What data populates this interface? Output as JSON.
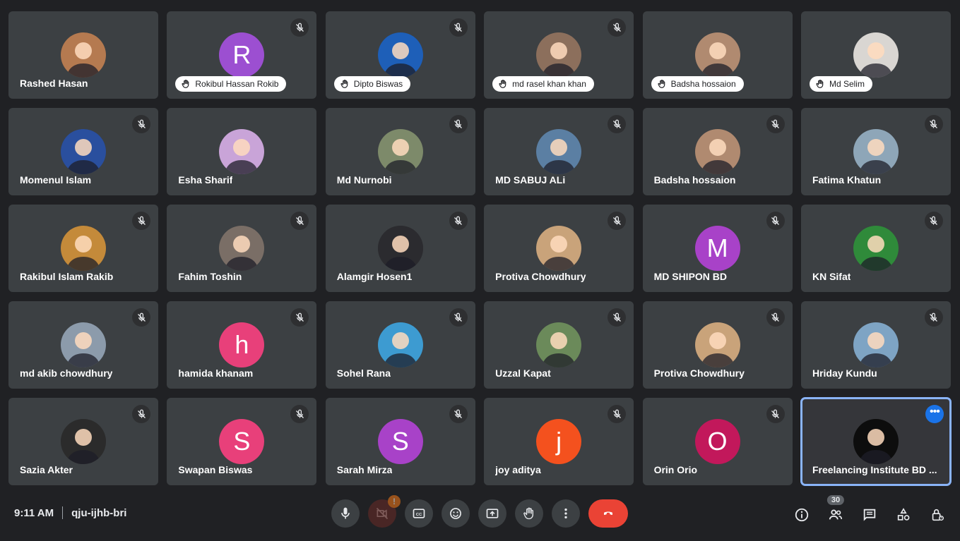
{
  "participants": [
    {
      "name": "Rashed Hasan",
      "avatar": "photo",
      "avatar_color": "#b57a50",
      "muted": false,
      "hand_raised": false
    },
    {
      "name": "Rokibul Hassan Rokib",
      "avatar": "R",
      "avatar_color": "#9c4fd1",
      "muted": true,
      "hand_raised": true
    },
    {
      "name": "Dipto Biswas",
      "avatar": "photo",
      "avatar_color": "#1e5fb8",
      "muted": true,
      "hand_raised": true
    },
    {
      "name": "md rasel khan khan",
      "avatar": "photo",
      "avatar_color": "#8c6f5c",
      "muted": true,
      "hand_raised": true
    },
    {
      "name": "Badsha hossaion",
      "avatar": "photo",
      "avatar_color": "#b08a70",
      "muted": false,
      "hand_raised": true
    },
    {
      "name": "Md Selim",
      "avatar": "photo",
      "avatar_color": "#d9d6d2",
      "muted": false,
      "hand_raised": true
    },
    {
      "name": "Momenul Islam",
      "avatar": "photo",
      "avatar_color": "#2a4f9e",
      "muted": true,
      "hand_raised": false
    },
    {
      "name": "Esha Sharif",
      "avatar": "photo",
      "avatar_color": "#c9a4d8",
      "muted": false,
      "hand_raised": false
    },
    {
      "name": "Md Nurnobi",
      "avatar": "photo",
      "avatar_color": "#7d8a6a",
      "muted": true,
      "hand_raised": false
    },
    {
      "name": "MD SABUJ ALi",
      "avatar": "photo",
      "avatar_color": "#5b7fa3",
      "muted": true,
      "hand_raised": false
    },
    {
      "name": "Badsha hossaion",
      "avatar": "photo",
      "avatar_color": "#b08a70",
      "muted": true,
      "hand_raised": false
    },
    {
      "name": "Fatima Khatun",
      "avatar": "photo",
      "avatar_color": "#8ea6b8",
      "muted": true,
      "hand_raised": false
    },
    {
      "name": "Rakibul Islam Rakib",
      "avatar": "photo",
      "avatar_color": "#c48a3a",
      "muted": true,
      "hand_raised": false
    },
    {
      "name": "Fahim Toshin",
      "avatar": "photo",
      "avatar_color": "#7a6e66",
      "muted": true,
      "hand_raised": false
    },
    {
      "name": "Alamgir Hosen1",
      "avatar": "photo",
      "avatar_color": "#2b2b2f",
      "muted": true,
      "hand_raised": false
    },
    {
      "name": "Protiva Chowdhury",
      "avatar": "photo",
      "avatar_color": "#c9a37a",
      "muted": true,
      "hand_raised": false
    },
    {
      "name": "MD SHIPON BD",
      "avatar": "M",
      "avatar_color": "#a842c8",
      "muted": true,
      "hand_raised": false
    },
    {
      "name": "KN Sifat",
      "avatar": "photo",
      "avatar_color": "#2f8a3a",
      "muted": true,
      "hand_raised": false
    },
    {
      "name": "md akib chowdhury",
      "avatar": "photo",
      "avatar_color": "#8c9bab",
      "muted": true,
      "hand_raised": false
    },
    {
      "name": "hamida khanam",
      "avatar": "h",
      "avatar_color": "#e8407a",
      "muted": true,
      "hand_raised": false
    },
    {
      "name": "Sohel Rana",
      "avatar": "photo",
      "avatar_color": "#3d9bd1",
      "muted": true,
      "hand_raised": false
    },
    {
      "name": "Uzzal Kapat",
      "avatar": "photo",
      "avatar_color": "#6b8a5a",
      "muted": true,
      "hand_raised": false
    },
    {
      "name": "Protiva Chowdhury",
      "avatar": "photo",
      "avatar_color": "#c9a37a",
      "muted": true,
      "hand_raised": false
    },
    {
      "name": "Hriday Kundu",
      "avatar": "photo",
      "avatar_color": "#7ea4c4",
      "muted": true,
      "hand_raised": false
    },
    {
      "name": "Sazia Akter",
      "avatar": "photo",
      "avatar_color": "#2b2b2b",
      "muted": true,
      "hand_raised": false
    },
    {
      "name": "Swapan Biswas",
      "avatar": "S",
      "avatar_color": "#e8407a",
      "muted": true,
      "hand_raised": false
    },
    {
      "name": "Sarah Mirza",
      "avatar": "S",
      "avatar_color": "#a842c8",
      "muted": true,
      "hand_raised": false
    },
    {
      "name": "joy aditya",
      "avatar": "j",
      "avatar_color": "#f4511e",
      "muted": true,
      "hand_raised": false
    },
    {
      "name": "Orin Orio",
      "avatar": "O",
      "avatar_color": "#c2185b",
      "muted": true,
      "hand_raised": false
    },
    {
      "name": "Freelancing Institute BD ...",
      "avatar": "photo",
      "avatar_color": "#0d0d0d",
      "muted": false,
      "hand_raised": false,
      "active": true
    }
  ],
  "meeting": {
    "time": "9:11 AM",
    "code": "qju-ijhb-bri"
  },
  "controls": [
    "mic-icon",
    "camera-off-icon",
    "captions-icon",
    "emoji-icon",
    "present-icon",
    "raise-hand-icon",
    "more-options-icon",
    "end-call-icon"
  ],
  "right_controls": {
    "participant_count": "30"
  },
  "colors": {
    "background": "#202124",
    "tile": "#3c4043",
    "end_call": "#ea4335",
    "active_border": "#8ab4f8"
  }
}
